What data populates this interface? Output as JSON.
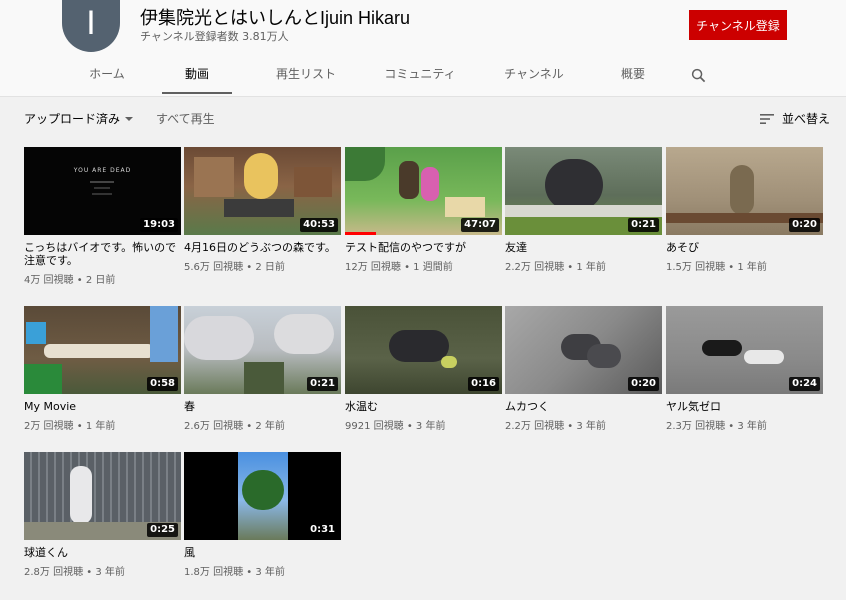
{
  "channel": {
    "avatar_letter": "I",
    "name": "伊集院光とはいしんとIjuin Hikaru",
    "subscribers": "チャンネル登録者数 3.81万人",
    "subscribe_label": "チャンネル登録"
  },
  "tabs": [
    {
      "label": "ホーム"
    },
    {
      "label": "動画"
    },
    {
      "label": "再生リスト"
    },
    {
      "label": "コミュニティ"
    },
    {
      "label": "チャンネル"
    },
    {
      "label": "概要"
    }
  ],
  "toolbar": {
    "filter_label": "アップロード済み",
    "play_all_label": "すべて再生",
    "sort_label": "並べ替え"
  },
  "videos": [
    {
      "title": "こっちはバイオです。怖いので注意です。",
      "duration": "19:03",
      "views": "4万 回視聴",
      "age": "2 日前",
      "thumb_text": "YOU ARE DEAD"
    },
    {
      "title": "4月16日のどうぶつの森です。",
      "duration": "40:53",
      "views": "5.6万 回視聴",
      "age": "2 日前"
    },
    {
      "title": "テスト配信のやつですが",
      "duration": "47:07",
      "views": "12万 回視聴",
      "age": "1 週間前",
      "progress": 0.2
    },
    {
      "title": "友達",
      "duration": "0:21",
      "views": "2.2万 回視聴",
      "age": "1 年前"
    },
    {
      "title": "あそび",
      "duration": "0:20",
      "views": "1.5万 回視聴",
      "age": "1 年前"
    },
    {
      "title": "My Movie",
      "duration": "0:58",
      "views": "2万 回視聴",
      "age": "1 年前"
    },
    {
      "title": "春",
      "duration": "0:21",
      "views": "2.6万 回視聴",
      "age": "2 年前"
    },
    {
      "title": "水温む",
      "duration": "0:16",
      "views": "9921 回視聴",
      "age": "3 年前"
    },
    {
      "title": "ムカつく",
      "duration": "0:20",
      "views": "2.2万 回視聴",
      "age": "3 年前"
    },
    {
      "title": "ヤル気ゼロ",
      "duration": "0:24",
      "views": "2.3万 回視聴",
      "age": "3 年前"
    },
    {
      "title": "球道くん",
      "duration": "0:25",
      "views": "2.8万 回視聴",
      "age": "3 年前"
    },
    {
      "title": "風",
      "duration": "0:31",
      "views": "1.8万 回視聴",
      "age": "3 年前"
    }
  ],
  "colors": {
    "accent": "#cc0000",
    "progress": "#ff0000",
    "avatar": "#546270"
  }
}
